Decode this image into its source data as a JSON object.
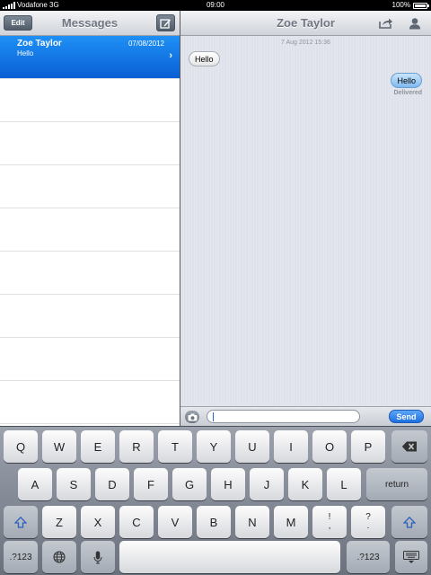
{
  "status_bar": {
    "carrier": "Vodafone 3G",
    "time": "09:00",
    "battery": "100%"
  },
  "left_pane": {
    "edit_label": "Edit",
    "title": "Messages",
    "conversations": [
      {
        "name": "Zoe Taylor",
        "date": "07/08/2012",
        "preview": "Hello"
      }
    ]
  },
  "conversation": {
    "title": "Zoe Taylor",
    "timestamp": "7 Aug 2012 15:36",
    "messages": [
      {
        "direction": "in",
        "text": "Hello"
      },
      {
        "direction": "out",
        "text": "Hello",
        "status": "Delivered"
      }
    ]
  },
  "composer": {
    "value": "",
    "send_label": "Send"
  },
  "keyboard": {
    "row1": [
      "Q",
      "W",
      "E",
      "R",
      "T",
      "Y",
      "U",
      "I",
      "O",
      "P"
    ],
    "row2": [
      "A",
      "S",
      "D",
      "F",
      "G",
      "H",
      "J",
      "K",
      "L"
    ],
    "row3": [
      "Z",
      "X",
      "C",
      "V",
      "B",
      "N",
      "M"
    ],
    "row3_punct": [
      {
        "top": "!",
        "bottom": ","
      },
      {
        "top": "?",
        "bottom": "."
      }
    ],
    "return_label": "return",
    "numbers_label": ".?123"
  },
  "icons": {
    "compose": "compose-icon",
    "share": "share-icon",
    "contact": "contact-icon",
    "camera": "camera-icon",
    "backspace": "backspace-icon",
    "shift": "shift-icon",
    "globe": "globe-icon",
    "microphone": "microphone-icon",
    "hide_keyboard": "hide-keyboard-icon"
  },
  "colors": {
    "selected_row": "#0a6de0",
    "send_button": "#1b6fe0",
    "outgoing_bubble": "#9cccf5"
  }
}
